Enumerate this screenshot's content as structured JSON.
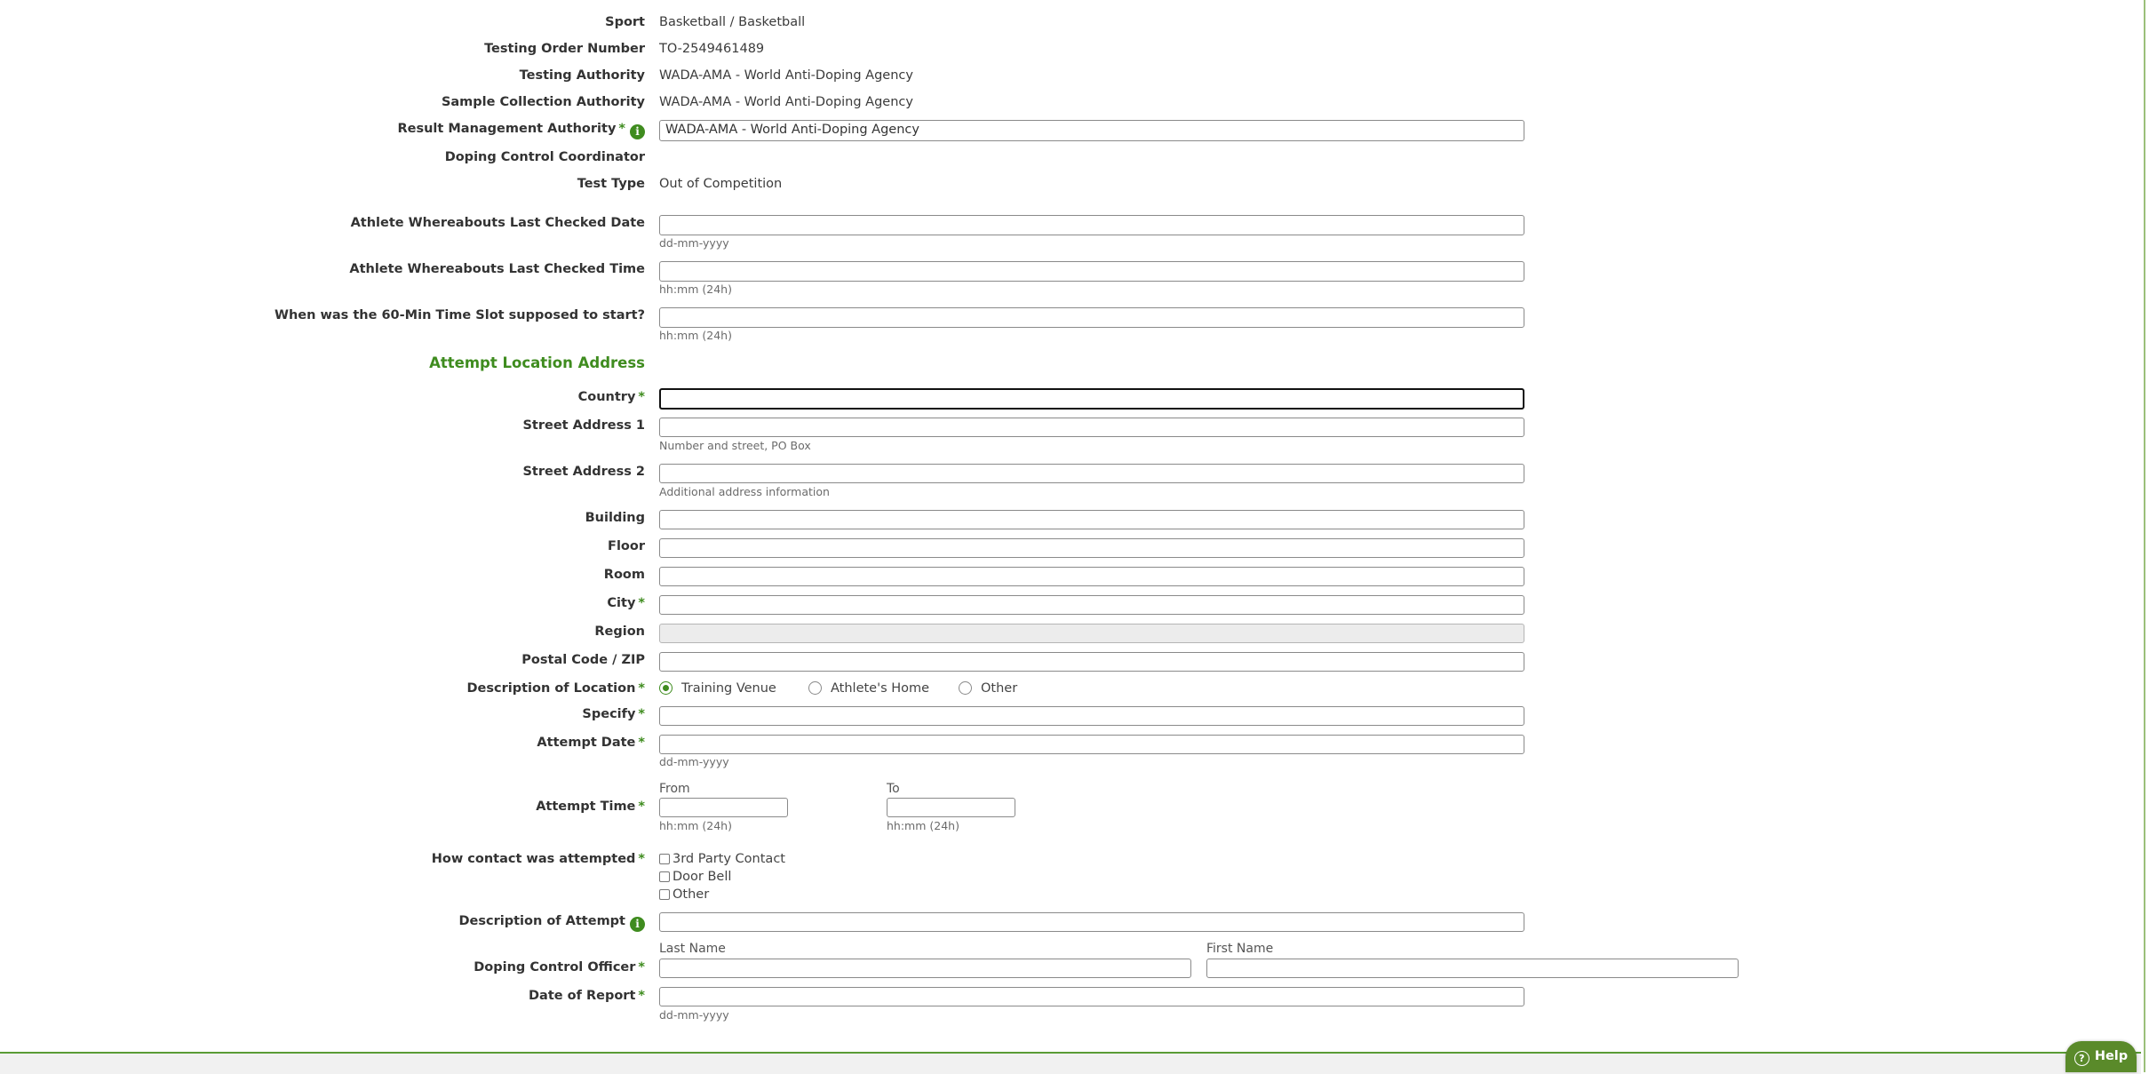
{
  "info_rows": [
    {
      "label": "Sport",
      "value": "Basketball / Basketball"
    },
    {
      "label": "Testing Order Number",
      "value": "TO-2549461489"
    },
    {
      "label": "Testing Authority",
      "value": "WADA-AMA - World Anti-Doping Agency"
    },
    {
      "label": "Sample Collection Authority",
      "value": "WADA-AMA - World Anti-Doping Agency"
    }
  ],
  "result_management": {
    "label": "Result Management Authority",
    "value": "WADA-AMA - World Anti-Doping Agency"
  },
  "doping_control_coordinator": {
    "label": "Doping Control Coordinator",
    "value": ""
  },
  "test_type": {
    "label": "Test Type",
    "value": "Out of Competition"
  },
  "whereabouts_date": {
    "label": "Athlete Whereabouts Last Checked Date",
    "hint": "dd-mm-yyyy"
  },
  "whereabouts_time": {
    "label": "Athlete Whereabouts Last Checked Time",
    "hint": "hh:mm (24h)"
  },
  "slot_start": {
    "label": "When was the 60-Min Time Slot supposed to start?",
    "hint": "hh:mm (24h)"
  },
  "address_section_title": "Attempt Location Address",
  "address": {
    "country": "Country",
    "street1": "Street Address 1",
    "street1_hint": "Number and street, PO Box",
    "street2": "Street Address 2",
    "street2_hint": "Additional address information",
    "building": "Building",
    "floor": "Floor",
    "room": "Room",
    "city": "City",
    "region": "Region",
    "postal": "Postal Code / ZIP"
  },
  "location_description": {
    "label": "Description of Location",
    "options": [
      "Training Venue",
      "Athlete's Home",
      "Other"
    ],
    "selected": "Training Venue"
  },
  "specify": {
    "label": "Specify"
  },
  "attempt_date": {
    "label": "Attempt Date",
    "hint": "dd-mm-yyyy"
  },
  "attempt_time": {
    "label": "Attempt Time",
    "from_label": "From",
    "from_hint": "hh:mm (24h)",
    "to_label": "To",
    "to_hint": "hh:mm (24h)"
  },
  "contact": {
    "label": "How contact was attempted",
    "options": [
      "3rd Party Contact",
      "Door Bell",
      "Other"
    ]
  },
  "attempt_description": {
    "label": "Description of Attempt"
  },
  "dco": {
    "label": "Doping Control Officer",
    "last_name": "Last Name",
    "first_name": "First Name"
  },
  "report_date": {
    "label": "Date of Report",
    "hint": "dd-mm-yyyy"
  },
  "required_mark": "*",
  "info_glyph": "i",
  "help": {
    "label": "Help",
    "glyph": "?"
  },
  "colors": {
    "accent": "#3f8c1f",
    "help_bg": "#5a8a2a"
  }
}
